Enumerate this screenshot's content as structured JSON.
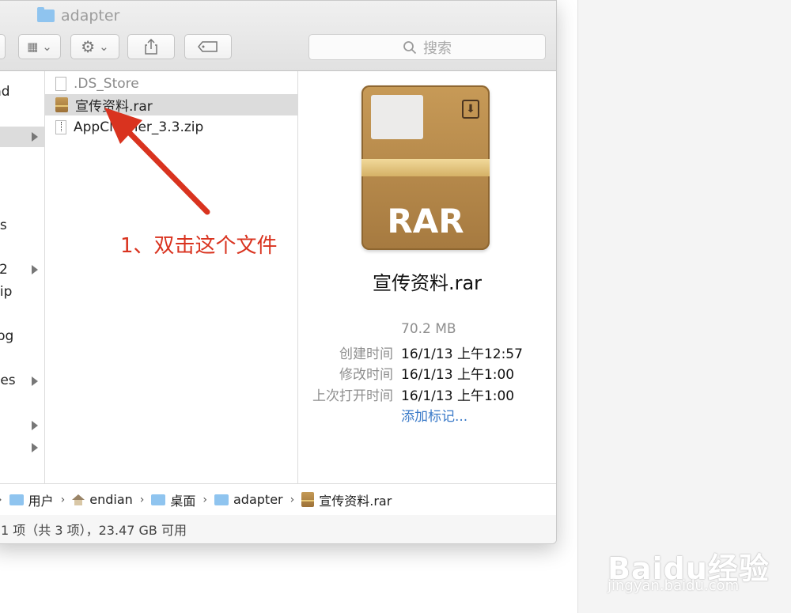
{
  "window": {
    "title": "adapter"
  },
  "search": {
    "placeholder": "搜索"
  },
  "sidebar_fragments": [
    "nd",
    "ss",
    "2",
    "zip",
    "jpg",
    "ces"
  ],
  "files": [
    {
      "name": ".DS_Store",
      "kind": "document",
      "selected": false
    },
    {
      "name": "宣传资料.rar",
      "kind": "rar",
      "selected": true
    },
    {
      "name": "AppCleaner_3.3.zip",
      "kind": "zip",
      "selected": false
    }
  ],
  "preview": {
    "icon_text": "RAR",
    "name": "宣传资料.rar",
    "size": "70.2 MB",
    "created_label": "创建时间",
    "created_value": "16/1/13 上午12:57",
    "modified_label": "修改时间",
    "modified_value": "16/1/13 上午1:00",
    "opened_label": "上次打开时间",
    "opened_value": "16/1/13 上午1:00",
    "add_tag": "添加标记..."
  },
  "pathbar": [
    {
      "label": "用户",
      "icon": "folder-icon"
    },
    {
      "label": "endian",
      "icon": "home-icon"
    },
    {
      "label": "桌面",
      "icon": "folder-icon"
    },
    {
      "label": "adapter",
      "icon": "folder-icon"
    },
    {
      "label": "宣传资料.rar",
      "icon": "rar-icon"
    }
  ],
  "status": "1 项（共 3 项），23.47 GB 可用",
  "annotation": {
    "text": "1、双击这个文件",
    "color": "#d9331f"
  },
  "watermark": {
    "logo": "Baidu经验",
    "url": "jingyan.baidu.com"
  }
}
